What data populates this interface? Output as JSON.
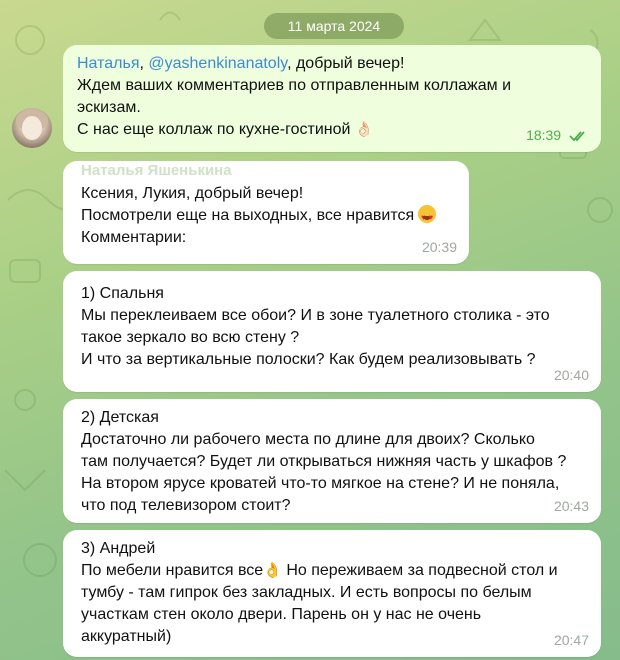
{
  "date_label": "11 марта 2024",
  "messages": [
    {
      "sender": "Наталья",
      "mention": "@yashenkinanatoly",
      "greeting": ", добрый вечер!",
      "line2": "Ждем ваших комментариев по отправленным коллажам и",
      "line3": "эскизам.",
      "line4": "С нас  еще коллаж по кухне-гостиной ",
      "emoji": "👌🏻",
      "time": "18:39"
    },
    {
      "sender": "Наталья Яшенькина",
      "line1": "Ксения, Лукия, добрый вечер!",
      "line2": "Посмотрели еще на выходных, все нравится",
      "line3": "Комментарии:",
      "time": "20:39"
    },
    {
      "line1": "1) Спальня",
      "line2": "Мы переклеиваем все обои? И в зоне туалетного столика - это",
      "line3": "такое зеркало во всю стену ?",
      "line4": "И что за вертикальные полоски? Как будем реализовывать ?",
      "time": "20:40"
    },
    {
      "line1": "2) Детская",
      "line2": "Достаточно ли рабочего места по длине для двоих?  Сколько",
      "line3": "там получается? Будет ли открываться нижняя часть у шкафов ?",
      "line4": "На втором ярусе кроватей что-то мягкое на стене? И не поняла,",
      "line5": "что под телевизором стоит?",
      "time": "20:43"
    },
    {
      "line1": "3) Андрей",
      "line2a": "По мебели нравится все",
      "emoji": "👌",
      "line2b": " Но переживаем за подвесной стол и",
      "line3": "тумбу - там гипрок без закладных. И есть вопросы по белым",
      "line4": "участкам стен около двери. Парень он у нас не очень",
      "line5": "аккуратный)",
      "time": "20:47"
    }
  ],
  "colors": {
    "outgoing_bubble": "#effedd",
    "incoming_bubble": "#ffffff",
    "link": "#3c8bd4",
    "read_check": "#4fae4e"
  }
}
